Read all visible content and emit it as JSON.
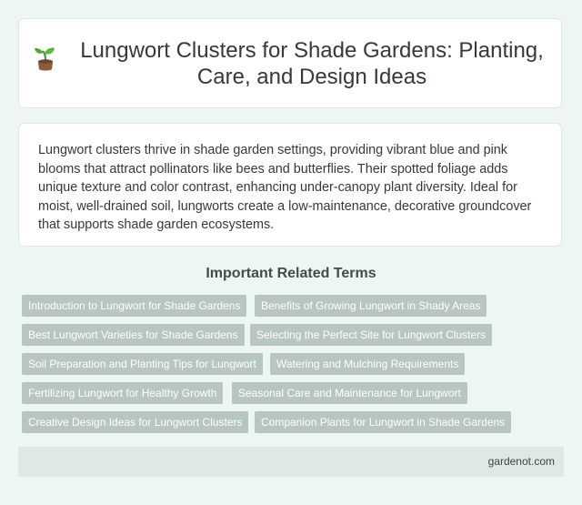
{
  "header": {
    "title": "Lungwort Clusters for Shade Gardens: Planting, Care, and Design Ideas",
    "icon": "sprout-icon"
  },
  "description": "Lungwort clusters thrive in shade garden settings, providing vibrant blue and pink blooms that attract pollinators like bees and butterflies. Their spotted foliage adds unique texture and color contrast, enhancing under-canopy plant diversity. Ideal for moist, well-drained soil, lungworts create a low-maintenance, decorative groundcover that supports shade garden ecosystems.",
  "related": {
    "title": "Important Related Terms",
    "terms": [
      "Introduction to Lungwort for Shade Gardens",
      "Benefits of Growing Lungwort in Shady Areas",
      "Best Lungwort Varieties for Shade Gardens",
      "Selecting the Perfect Site for Lungwort Clusters",
      "Soil Preparation and Planting Tips for Lungwort",
      "Watering and Mulching Requirements",
      "Fertilizing Lungwort for Healthy Growth",
      "Seasonal Care and Maintenance for Lungwort",
      "Creative Design Ideas for Lungwort Clusters",
      "Companion Plants for Lungwort in Shade Gardens"
    ]
  },
  "footer": {
    "site": "gardenot.com"
  },
  "colors": {
    "background": "#eef6f1",
    "tag": "#b8c6c1",
    "footer": "#dfe8e3"
  }
}
